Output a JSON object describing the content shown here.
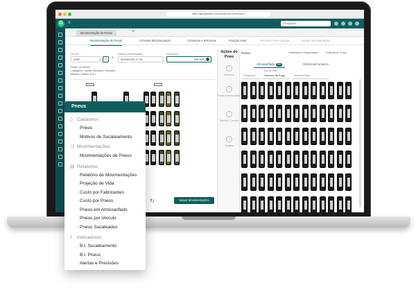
{
  "browser": {
    "url": "https://app.gefrotas.com.br/pneus/movimentacao"
  },
  "header": {
    "logo": "G",
    "search_placeholder": "Pesquisar..."
  },
  "tabs": {
    "active": "Movimentação de Pneus",
    "add": "+"
  },
  "subnav": [
    "Movimentação de Pneus",
    "Consulta Movimentação",
    "Consertos e Reformas",
    "Posição Atual",
    "Remover Pneu Sucata",
    "Excluir Movimentação"
  ],
  "form": {
    "veiculo_label": "Veículo",
    "veiculo_value": "1020",
    "data_label": "Data da Movimentação",
    "data_value": "02/03/2020 17:44",
    "hodometro_label": "Hodômetro",
    "hodometro_value": "205.000"
  },
  "vehicle_info": {
    "line1": "Placa: OLA4D20",
    "line2": "Categoria: Cavalo Mecânico Truckado",
    "line3": "Modelo: Scania 124 L"
  },
  "actions": {
    "title": "Ações do Pneu",
    "items": [
      "Selecionar",
      "Enviar ao Almoxarifado",
      "Reforma / Conserto",
      "Sucatear"
    ]
  },
  "right": {
    "title": "Pneus",
    "legend1": "Hodômetro e Observações",
    "legend2": "Legenda de Cores",
    "tab_almox": "Almoxarifado",
    "tab_almox_count": "180",
    "tab_reforma": "Reforma/Conserto",
    "filter_label": "Tipo de Filtro",
    "filter_search": "Pesquisar",
    "filter_select": "Número de Fogo",
    "filter_status": "Almoxarifado"
  },
  "buttons": {
    "save": "Salvar Movimentações"
  },
  "menu": {
    "title": "Pneus",
    "sections": [
      {
        "label": "Cadastros",
        "icon": "document-icon",
        "items": [
          "Pneus",
          "Motivos de Sucateamento"
        ]
      },
      {
        "label": "Movimentações",
        "icon": "shuffle-icon",
        "items": [
          "Movimentações de Pneus"
        ]
      },
      {
        "label": "Relatórios",
        "icon": "report-icon",
        "items": [
          "Relatório de Movimentações",
          "Projeção de Vida",
          "Custo por Fabricantes",
          "Custo por Pneus",
          "Pneus em Almoxarifado",
          "Pneus por Veículo",
          "Pneus Sucateados"
        ]
      },
      {
        "label": "Indicadores",
        "icon": "chart-icon",
        "items": [
          "B.I. Sucateamento",
          "B.I. Pneus",
          "Alertas e Previsões"
        ]
      }
    ]
  }
}
